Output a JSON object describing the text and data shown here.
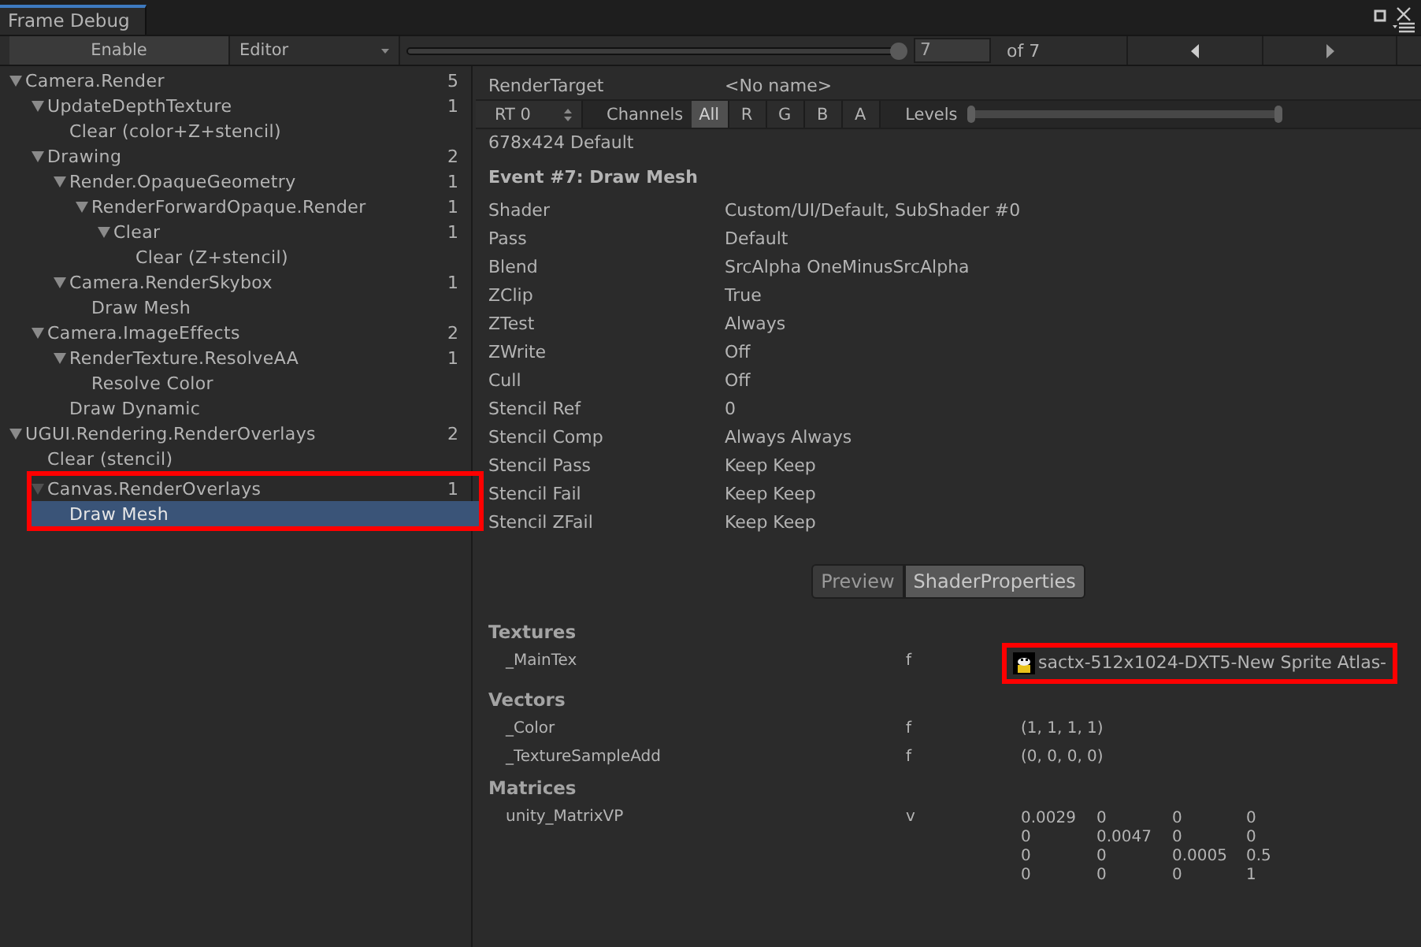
{
  "window": {
    "tab": "Frame Debug"
  },
  "toolbar": {
    "enable_button": "Enable",
    "target_dropdown": "Editor",
    "event_slider": {
      "level": 1
    },
    "event_field": "7",
    "event_count": "of 7"
  },
  "tree": [
    {
      "label": "Camera.Render",
      "count": "5",
      "expanded": true,
      "selected": false,
      "highlighted": false,
      "children": [
        {
          "label": "UpdateDepthTexture",
          "count": "1",
          "expanded": true,
          "selected": false,
          "highlighted": false,
          "children": [
            {
              "label": "Clear (color+Z+stencil)",
              "selected": false,
              "highlighted": false
            }
          ]
        },
        {
          "label": "Drawing",
          "count": "2",
          "expanded": true,
          "selected": false,
          "highlighted": false,
          "children": [
            {
              "label": "Render.OpaqueGeometry",
              "count": "1",
              "expanded": true,
              "selected": false,
              "highlighted": false,
              "children": [
                {
                  "label": "RenderForwardOpaque.Render",
                  "count": "1",
                  "expanded": true,
                  "selected": false,
                  "highlighted": false,
                  "children": [
                    {
                      "label": "Clear",
                      "count": "1",
                      "expanded": true,
                      "selected": false,
                      "highlighted": false,
                      "children": [
                        {
                          "label": "Clear (Z+stencil)",
                          "selected": false,
                          "highlighted": false
                        }
                      ]
                    }
                  ]
                }
              ]
            },
            {
              "label": "Camera.RenderSkybox",
              "count": "1",
              "expanded": true,
              "selected": false,
              "highlighted": false,
              "children": [
                {
                  "label": "Draw Mesh",
                  "selected": false,
                  "highlighted": false
                }
              ]
            }
          ]
        },
        {
          "label": "Camera.ImageEffects",
          "count": "2",
          "expanded": true,
          "selected": false,
          "highlighted": false,
          "children": [
            {
              "label": "RenderTexture.ResolveAA",
              "count": "1",
              "expanded": true,
              "selected": false,
              "highlighted": false,
              "children": [
                {
                  "label": "Resolve Color",
                  "selected": false,
                  "highlighted": false
                }
              ]
            },
            {
              "label": "Draw Dynamic",
              "selected": false,
              "highlighted": false
            }
          ]
        }
      ]
    },
    {
      "label": "UGUI.Rendering.RenderOverlays",
      "count": "2",
      "expanded": true,
      "selected": false,
      "highlighted": false,
      "children": [
        {
          "label": "Clear (stencil)",
          "selected": false,
          "highlighted": false
        },
        {
          "label": "Canvas.RenderOverlays",
          "count": "1",
          "expanded": true,
          "selected": false,
          "highlighted": true,
          "children": [
            {
              "label": "Draw Mesh",
              "selected": true,
              "highlighted": false
            }
          ]
        }
      ]
    }
  ],
  "details": {
    "render_target": {
      "label": "RenderTarget",
      "value": "<No name>"
    },
    "rt_dropdown": "RT 0",
    "channels_label": "Channels",
    "channels": [
      {
        "label": "All",
        "selected": true
      },
      {
        "label": "R",
        "selected": false
      },
      {
        "label": "G",
        "selected": false
      },
      {
        "label": "B",
        "selected": false
      },
      {
        "label": "A",
        "selected": false
      }
    ],
    "levels_label": "Levels",
    "levels_slider": {
      "level": 1
    },
    "resolution": "678x424 Default",
    "event_title": "Event #7: Draw Mesh",
    "properties": [
      {
        "name": "Shader",
        "value": "Custom/UI/Default, SubShader #0"
      },
      {
        "name": "Pass",
        "value": "Default"
      },
      {
        "name": "Blend",
        "value": "SrcAlpha OneMinusSrcAlpha"
      },
      {
        "name": "ZClip",
        "value": "True"
      },
      {
        "name": "ZTest",
        "value": "Always"
      },
      {
        "name": "ZWrite",
        "value": "Off"
      },
      {
        "name": "Cull",
        "value": "Off"
      },
      {
        "name": "Stencil Ref",
        "value": "0"
      },
      {
        "name": "Stencil Comp",
        "value": "Always Always"
      },
      {
        "name": "Stencil Pass",
        "value": "Keep Keep"
      },
      {
        "name": "Stencil Fail",
        "value": "Keep Keep"
      },
      {
        "name": "Stencil ZFail",
        "value": "Keep Keep"
      }
    ],
    "view_tabs": [
      {
        "label": "Preview",
        "selected": false
      },
      {
        "label": "ShaderProperties",
        "selected": true
      }
    ],
    "shader_properties": [
      {
        "heading": "Textures",
        "rows": [
          {
            "kind": "texture",
            "name": "_MainTex",
            "type": "f",
            "value": "sactx-512x1024-DXT5-New Sprite Atlas-",
            "highlighted": true
          }
        ]
      },
      {
        "heading": "Vectors",
        "rows": [
          {
            "kind": "text",
            "name": "_Color",
            "type": "f",
            "value": "(1, 1, 1, 1)",
            "highlighted": false
          },
          {
            "kind": "text",
            "name": "_TextureSampleAdd",
            "type": "f",
            "value": "(0, 0, 0, 0)",
            "highlighted": false
          }
        ]
      },
      {
        "heading": "Matrices",
        "rows": [
          {
            "kind": "matrix",
            "name": "unity_MatrixVP",
            "type": "v",
            "matrix": [
              [
                "0.0029",
                "0",
                "0",
                "0"
              ],
              [
                "0",
                "0.0047",
                "0",
                "0"
              ],
              [
                "0",
                "0",
                "0.0005",
                "0.5"
              ],
              [
                "0",
                "0",
                "0",
                "1"
              ]
            ],
            "highlighted": false
          }
        ]
      }
    ]
  }
}
